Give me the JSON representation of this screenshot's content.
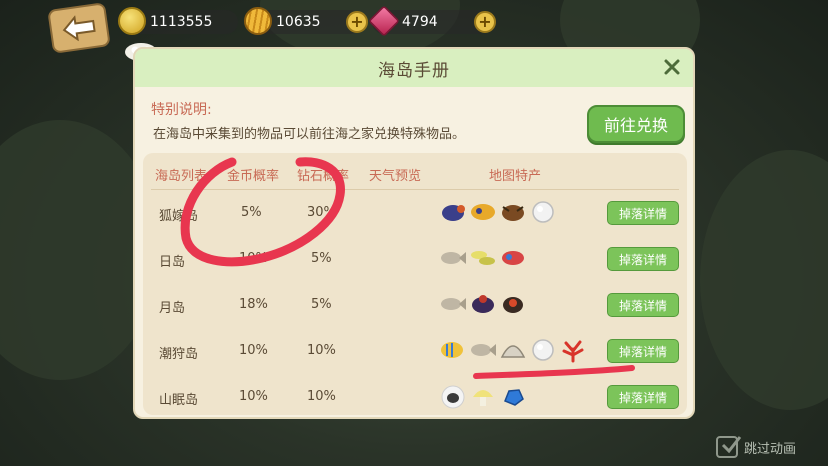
{
  "currency": {
    "gold": {
      "value": "1113555",
      "icon": "gold-coin-icon",
      "color": "#e8c43d"
    },
    "shell": {
      "value": "10635",
      "icon": "shell-icon",
      "color": "#e6a62b"
    },
    "gem": {
      "value": "4794",
      "icon": "gem-icon",
      "color": "#d9467a"
    }
  },
  "dialog": {
    "title": "海岛手册",
    "note_title": "特别说明:",
    "note_text": "在海岛中采集到的物品可以前往海之家兑换特殊物品。",
    "exchange_label": "前往兑换",
    "headers": [
      "海岛列表",
      "金币概率",
      "钻石概率",
      "天气预览",
      "地图特产"
    ],
    "drop_label": "掉落详情",
    "rows": [
      {
        "name": "狐嫁岛",
        "gold": "5%",
        "diamond": "30%",
        "items": [
          "bug",
          "bug",
          "bug",
          "pearl"
        ]
      },
      {
        "name": "日岛",
        "gold": "10%",
        "diamond": "5%",
        "items": [
          "fish",
          "bug",
          "bug"
        ]
      },
      {
        "name": "月岛",
        "gold": "18%",
        "diamond": "5%",
        "items": [
          "fish",
          "bug",
          "bug"
        ]
      },
      {
        "name": "潮狩岛",
        "gold": "10%",
        "diamond": "10%",
        "items": [
          "fish",
          "fish",
          "shell",
          "pearl",
          "coral"
        ]
      },
      {
        "name": "山眠岛",
        "gold": "10%",
        "diamond": "10%",
        "items": [
          "sheep",
          "mushroom",
          "ore"
        ]
      }
    ]
  },
  "skip_label": "跳过动画",
  "annotation_color": "#e8364f"
}
